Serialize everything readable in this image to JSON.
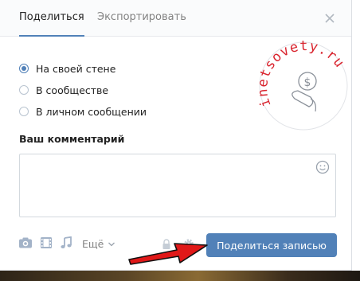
{
  "tabs": [
    {
      "label": "Поделиться",
      "active": true
    },
    {
      "label": "Экспортировать",
      "active": false
    }
  ],
  "options": [
    {
      "label": "На своей стене",
      "selected": true
    },
    {
      "label": "В сообществе",
      "selected": false
    },
    {
      "label": "В личном сообщении",
      "selected": false
    }
  ],
  "comment": {
    "label": "Ваш комментарий",
    "value": ""
  },
  "attachments": {
    "icons": [
      "camera-icon",
      "film-icon",
      "music-note-icon",
      "lock-icon",
      "gear-icon"
    ],
    "more_label": "Ещё"
  },
  "share_button_label": "Поделиться записью",
  "watermark": {
    "text": "inetsovety.ru",
    "color": "#d9242e"
  },
  "colors": {
    "accent": "#5181b8",
    "header_bg": "#fafbfc",
    "arrow": "#e01818"
  }
}
